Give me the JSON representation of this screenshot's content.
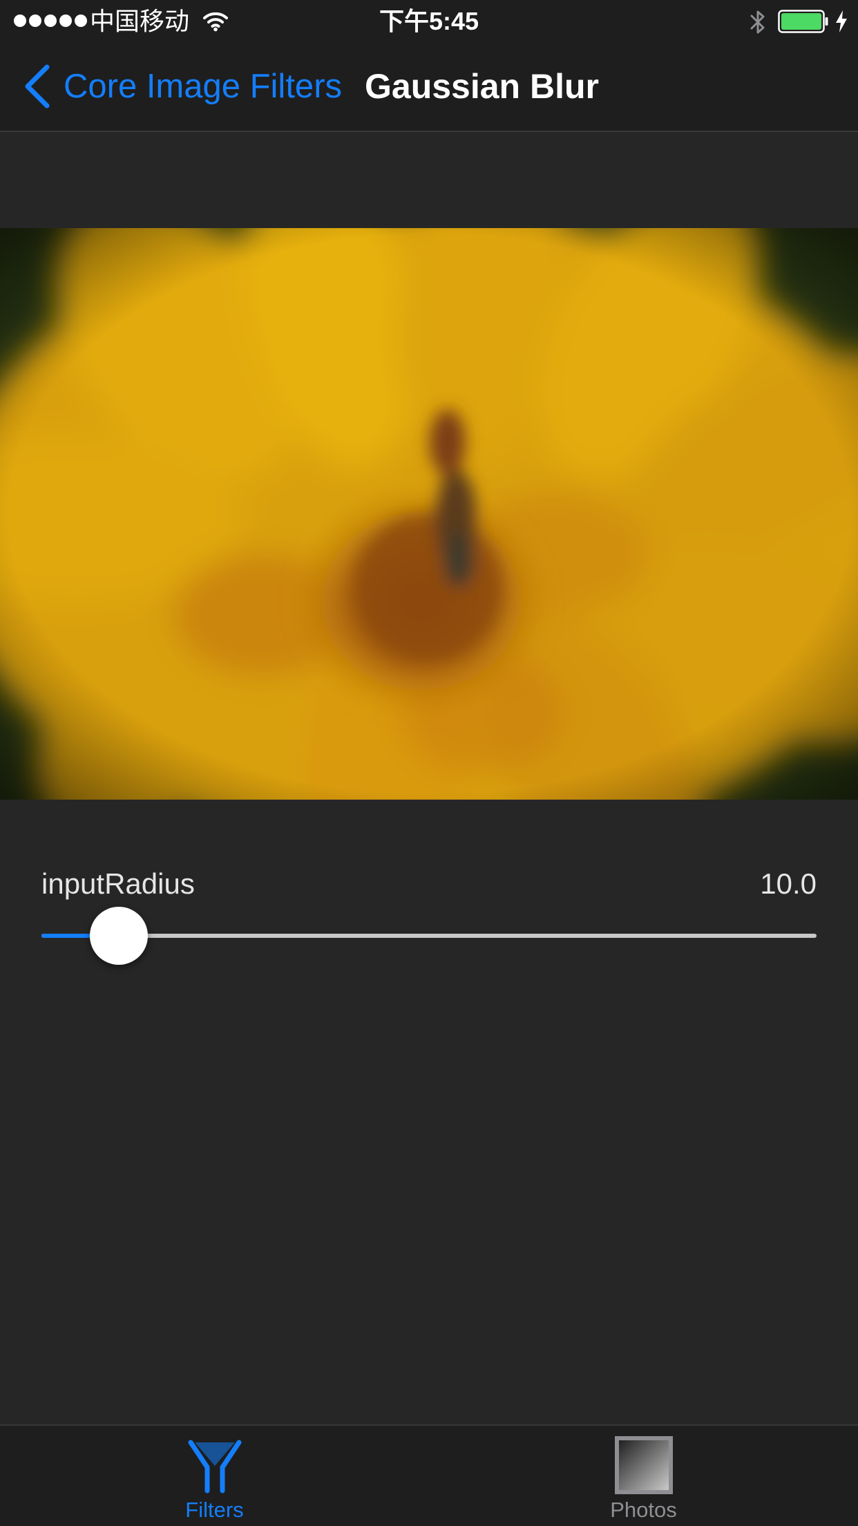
{
  "status_bar": {
    "signal_dots": 5,
    "carrier": "中国移动",
    "time": "下午5:45",
    "icons": [
      "wifi-icon",
      "bluetooth-icon",
      "battery-icon",
      "charging-icon"
    ],
    "battery_color": "#4cd964"
  },
  "nav": {
    "back_label": "Core Image Filters",
    "back_icon": "chevron-left-icon",
    "title": "Gaussian Blur",
    "accent_color": "#147efb"
  },
  "preview": {
    "icon": "filtered-photo-image",
    "colors": {
      "petal": "#e3a80a",
      "center": "#8e4a0c",
      "background": "#2a3a14"
    }
  },
  "parameter": {
    "name": "inputRadius",
    "value_label": "10.0",
    "slider_fraction": 0.1
  },
  "tab_bar": {
    "selected_color": "#147efb",
    "unselected_color": "#8e8e93",
    "tabs": [
      {
        "label": "Filters",
        "icon": "filter-y-icon",
        "selected": true
      },
      {
        "label": "Photos",
        "icon": "photo-square-icon",
        "selected": false
      }
    ]
  }
}
